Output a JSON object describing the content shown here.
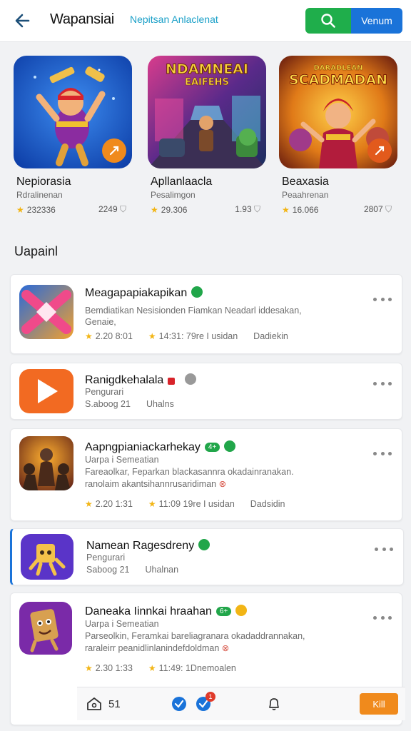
{
  "header": {
    "title": "Wapansiai",
    "subtitle": "Nepitsan Anlaclenat",
    "primary_label": "Venum",
    "colors": {
      "search": "#1fae4b",
      "primary": "#1a73d9"
    }
  },
  "featured": [
    {
      "name": "Nepiorasia",
      "category": "Rdralinenan",
      "rating": "232336",
      "downloads": "2249"
    },
    {
      "name": "Apllanlaacla",
      "category": "Pesalimgon",
      "rating": "29.306",
      "downloads": "1.93",
      "art_title_line1": "NDAMNEAI",
      "art_title_line2": "EAIFEHS"
    },
    {
      "name": "Beaxasia",
      "category": "Peaahrenan",
      "rating": "16.066",
      "downloads": "2807",
      "art_title_line1": "DARADLEAN",
      "art_title_line2": "SCADMADAN"
    }
  ],
  "section_title": "Uapainl",
  "apps": [
    {
      "name": "Meagapapiakapikan",
      "line1": "Bemdiatikan Nesisionden Fiamkan Neadarl iddesakan,",
      "line2": "Genaie,",
      "rating": "2.20 8:01",
      "installs": "14:31: 79re I usidan",
      "extra": "Dadiekin"
    },
    {
      "name": "Ranigdkehalala",
      "line1": "Pengurari",
      "size": "S.aboog 21",
      "updated": "Uhalns"
    },
    {
      "name": "Aapngpianiackarhekay",
      "chip": "4+",
      "line1": "Uarpa i Semeatian",
      "line2": "Fareaolkar, Feparkan blackasannra okadainranakan.",
      "line3": "ranolaim akantsihannrusaridiman",
      "rating": "2.20 1:31",
      "installs": "11:09 19re I usidan",
      "extra": "Dadsidin"
    },
    {
      "name": "Namean Ragesdreny",
      "line1": "Pengurari",
      "size": "Saboog 21",
      "updated": "Uhalnan"
    },
    {
      "name": "Daneaka Iinnkai hraahan",
      "chip": "6+",
      "line1": "Uarpa i Semeatian",
      "line2": "Parseolkin, Feramkai bareliagranara okadaddrannakan,",
      "line3": "raraleirr peanidlinlanindefdoldman",
      "rating": "2.30 1:33",
      "installs": "11:49: 1Dnemoalen"
    }
  ],
  "bottom_nav": {
    "home_count": "51",
    "notification_count": "1",
    "install_label": "Kill"
  }
}
